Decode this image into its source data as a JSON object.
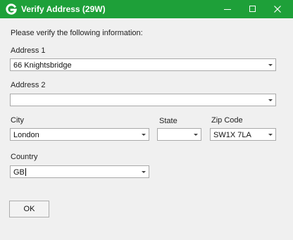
{
  "window": {
    "title": "Verify Address (29W)",
    "accent_color": "#1ea039",
    "icons": {
      "app": "g-logo-icon",
      "minimize": "minimize-icon",
      "maximize": "maximize-icon",
      "close": "close-icon"
    }
  },
  "form": {
    "instructions": "Please verify the following information:",
    "address1": {
      "label": "Address 1",
      "value": "66 Knightsbridge"
    },
    "address2": {
      "label": "Address 2",
      "value": ""
    },
    "city": {
      "label": "City",
      "value": "London"
    },
    "state": {
      "label": "State",
      "value": ""
    },
    "zip": {
      "label": "Zip Code",
      "value": "SW1X 7LA"
    },
    "country": {
      "label": "Country",
      "value": "GB"
    }
  },
  "buttons": {
    "ok": "OK"
  }
}
